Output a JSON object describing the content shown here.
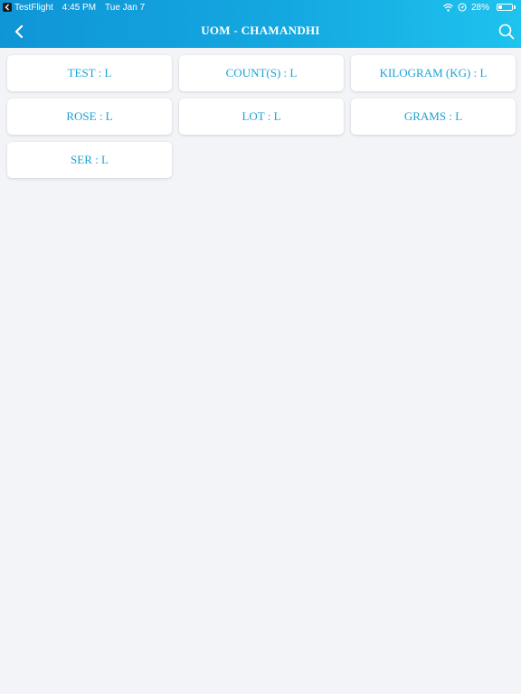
{
  "status_bar": {
    "app": "TestFlight",
    "time": "4:45 PM",
    "date": "Tue Jan 7",
    "battery": "28%",
    "battery_level": 0.28,
    "icons": [
      "wifi-icon",
      "location-icon",
      "battery-icon"
    ]
  },
  "navbar": {
    "title": "UOM - CHAMANDHI",
    "back_icon": "chevron-left-icon",
    "search_icon": "search-icon"
  },
  "items": [
    {
      "label": "TEST : L"
    },
    {
      "label": "COUNT(S) : L"
    },
    {
      "label": "KILOGRAM (KG) : L"
    },
    {
      "label": "ROSE : L"
    },
    {
      "label": "LOT : L"
    },
    {
      "label": "GRAMS : L"
    },
    {
      "label": "SER : L"
    }
  ],
  "colors": {
    "header_gradient_start": "#0f95d6",
    "header_gradient_end": "#1ec3ee",
    "card_text": "#1aa3d3",
    "background": "#f2f4f8"
  }
}
